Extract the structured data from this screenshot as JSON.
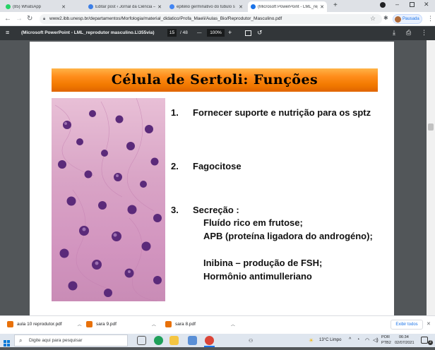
{
  "browser": {
    "tabs": [
      {
        "label": "(85) WhatsApp",
        "favicon_color": "#25d366",
        "active": false
      },
      {
        "label": "Editar post ‹ Jornal da Ciência —",
        "favicon_color": "#3d7fe6",
        "active": false
      },
      {
        "label": "epitélio germinativo do túbulo s",
        "favicon_color": "#4285f4",
        "active": false
      },
      {
        "label": "(Microsoft PowerPoint - LML_rep",
        "favicon_color": "#1a73e8",
        "active": true
      }
    ],
    "new_tab": "+",
    "url": "www2.ibb.unesp.br/departamentos/Morfologia/material_didatico/Profa_Maeli/Aulas_Bio/Reprodutor_Masculino.pdf",
    "profile_label": "Pausada"
  },
  "pdf_toolbar": {
    "title": "(Microsoft PowerPoint - LML_reprodutor masculino.L\\355via)",
    "current_page": "15",
    "total_pages": "/ 48",
    "zoom": "100%",
    "zoom_out": "—",
    "zoom_in": "+"
  },
  "slide": {
    "title": "Célula de Sertoli: Funções",
    "items": [
      {
        "number": "1.",
        "text": "Fornecer suporte e nutrição para os sptz"
      },
      {
        "number": "2.",
        "text": "Fagocitose"
      },
      {
        "number": "3.",
        "text": "Secreção :"
      }
    ],
    "sub_items": [
      "Fluído rico em frutose;",
      "APB (proteína ligadora do androgéno);",
      "Inibina – produção de FSH;",
      "Hormônio antimulleriano"
    ]
  },
  "downloads": {
    "items": [
      {
        "label": "aula 10 reprodutor.pdf"
      },
      {
        "label": "sara 9.pdf"
      },
      {
        "label": "sara 8.pdf"
      }
    ],
    "show_all": "Exibir todos",
    "close": "✕"
  },
  "taskbar": {
    "search_placeholder": "Digite aqui para pesquisar",
    "weather": "13°C  Limpo",
    "language": "POR",
    "layout": "PTB2",
    "time": "06:34",
    "date": "02/07/2021",
    "notification_count": "2"
  },
  "colors": {
    "title_bar_top": "#ffb347",
    "title_bar_bottom": "#e06500",
    "pdf_toolbar": "#323639",
    "viewer_bg": "#525659"
  }
}
